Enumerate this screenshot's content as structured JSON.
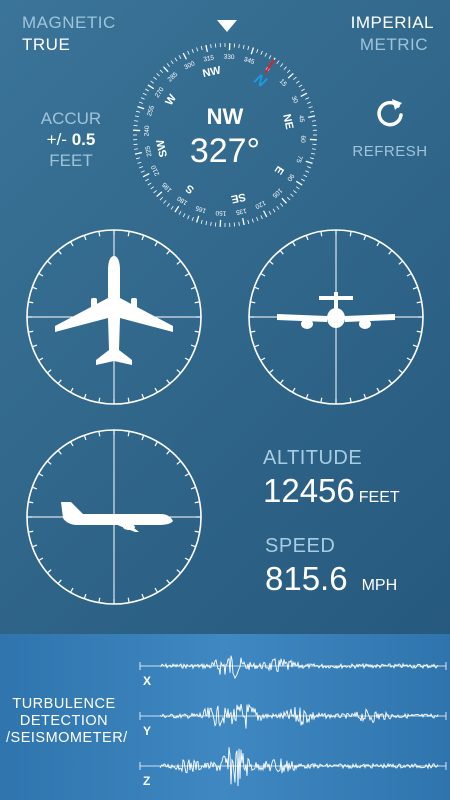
{
  "header": {
    "magnetic_label": "MAGNETIC",
    "true_label": "TRUE",
    "imperial_label": "IMPERIAL",
    "metric_label": "METRIC"
  },
  "accuracy": {
    "title": "ACCUR",
    "prefix": "+/-",
    "value": "0.5",
    "unit": "FEET"
  },
  "refresh": {
    "label": "REFRESH",
    "icon": "refresh-icon"
  },
  "compass": {
    "direction": "NW",
    "heading": "327°",
    "heading_deg": 327,
    "north_label": "N",
    "cardinals": [
      "N",
      "NE",
      "E",
      "SE",
      "S",
      "SW",
      "W",
      "NW"
    ],
    "degree_marks": [
      "0",
      "15",
      "30",
      "45",
      "60",
      "75",
      "90",
      "105",
      "120",
      "135",
      "150",
      "165",
      "180",
      "195",
      "210",
      "225",
      "240",
      "255",
      "270",
      "285",
      "300",
      "315",
      "330",
      "345"
    ]
  },
  "altitude": {
    "title": "ALTITUDE",
    "value": "12456",
    "unit": "FEET"
  },
  "speed": {
    "title": "SPEED",
    "value": "815.6",
    "unit": "MPH"
  },
  "turbulence": {
    "label_line1": "TURBULENCE",
    "label_line2": "DETECTION",
    "label_line3": "/SEISMOMETER/",
    "axes": [
      "X",
      "Y",
      "Z"
    ]
  },
  "colors": {
    "accent_blue": "#1c9be0",
    "north_red": "#e02020"
  }
}
